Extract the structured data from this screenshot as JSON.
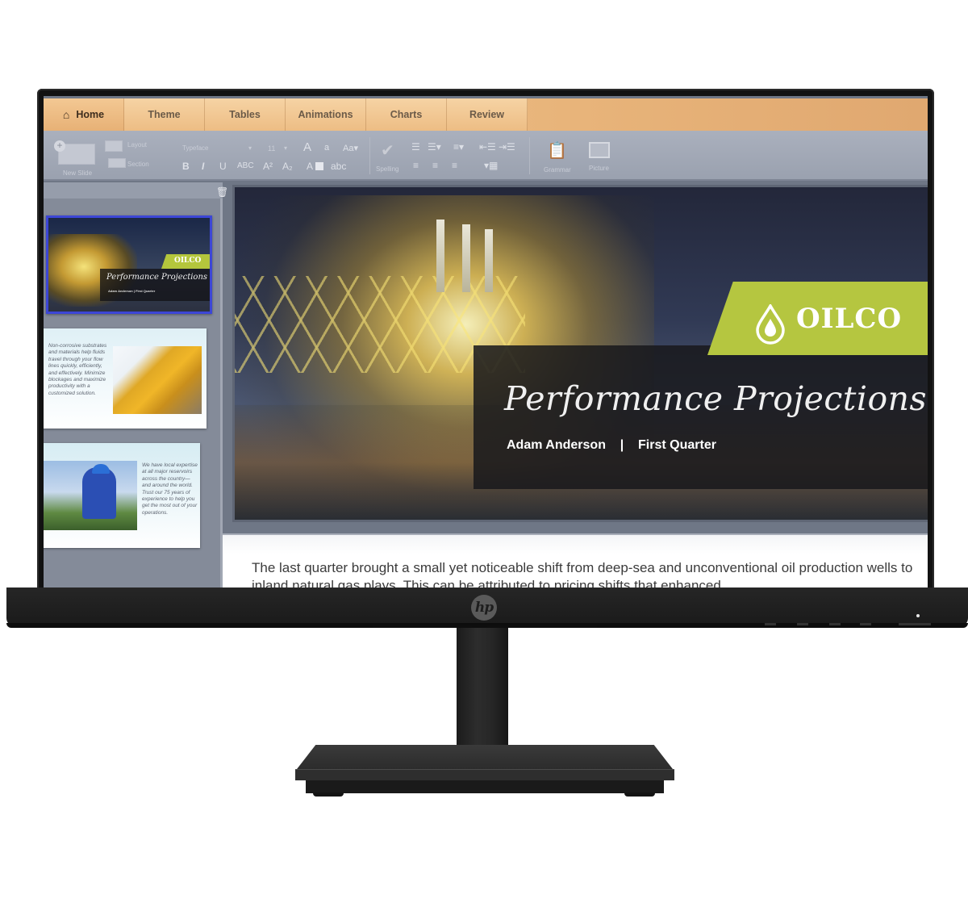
{
  "device": {
    "brand_logo": "hp",
    "icons": {
      "power_led": "power-led-icon"
    }
  },
  "ribbon": {
    "tabs": [
      {
        "label": "Home",
        "icon": "home-icon",
        "active": true
      },
      {
        "label": "Theme"
      },
      {
        "label": "Tables"
      },
      {
        "label": "Animations"
      },
      {
        "label": "Charts"
      },
      {
        "label": "Review"
      }
    ],
    "toolbar": {
      "new_slide": "New Slide",
      "layout": "Layout",
      "section": "Section",
      "typeface_placeholder": "Typeface",
      "font_size": "11",
      "grow_font": "A",
      "shrink_font": "a",
      "change_case": "Aa▾",
      "bold": "B",
      "italic": "I",
      "underline": "U",
      "strikethrough": "ABC",
      "superscript": "A²",
      "subscript": "A₂",
      "highlight": "A",
      "lowercase": "abc",
      "spelling": "Spelling",
      "grammar": "Grammar",
      "picture": "Picture"
    }
  },
  "slide_panel": {
    "thumbnails": [
      {
        "selected": true,
        "brand": "OILCO",
        "title": "Performance Projections",
        "subtitle": "Adam Anderson   |   First Quarter"
      },
      {
        "text": "Non-corrosive substrates and materials help fluids travel through your flow lines quickly, efficiently, and effectively. Minimize blockages and maximize productivity with a customized solution."
      },
      {
        "text": "We have local expertise at all major reservoirs across the country—and around the world. Trust our 75 years of experience to help you get the most out of your operations."
      }
    ]
  },
  "main_slide": {
    "brand": "OILCO",
    "title": "Performance Projections",
    "presenter": "Adam Anderson",
    "separator": "|",
    "period": "First Quarter",
    "accent_color": "#b5c640"
  },
  "notes": {
    "text": "The last quarter brought a small yet noticeable shift from deep-sea and unconventional oil production wells to inland natural gas plays. This can be attributed to pricing shifts that enhanced"
  }
}
